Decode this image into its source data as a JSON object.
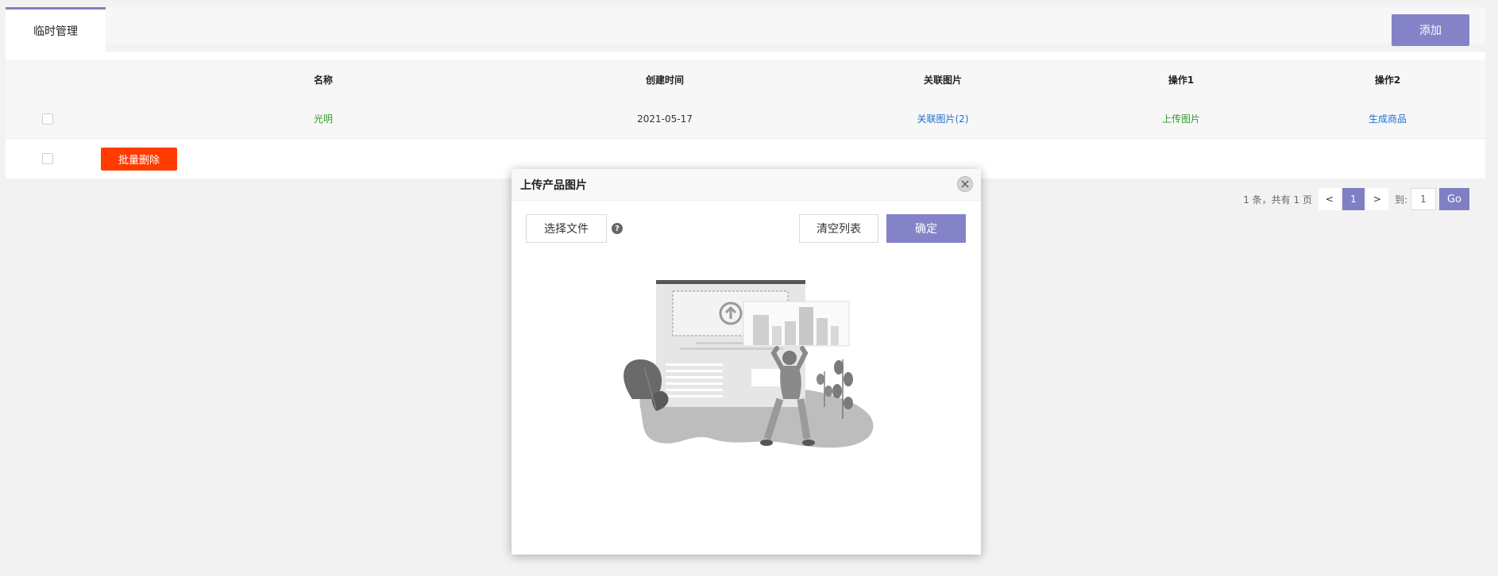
{
  "tabs": [
    {
      "label": "临时管理",
      "active": true
    }
  ],
  "header": {
    "add_label": "添加"
  },
  "table": {
    "columns": [
      "名称",
      "创建时间",
      "关联图片",
      "操作1",
      "操作2"
    ],
    "rows": [
      {
        "name": "光明",
        "created": "2021-05-17",
        "images": "关联图片(2)",
        "action1": "上传图片",
        "action2": "生成商品"
      }
    ]
  },
  "bulk": {
    "delete_label": "批量删除"
  },
  "pagination": {
    "info": "1 条，共有 1 页",
    "prev": "<",
    "current": "1",
    "next": ">",
    "goto_label": "到:",
    "goto_value": "1",
    "go_label": "Go"
  },
  "modal": {
    "title": "上传产品图片",
    "choose_file": "选择文件",
    "help_icon": "?",
    "clear_list": "清空列表",
    "confirm": "确定"
  },
  "colors": {
    "accent": "#8583c7",
    "danger": "#ff3c00",
    "link_green": "#2e9d2e",
    "link_blue": "#1b6fd0"
  }
}
